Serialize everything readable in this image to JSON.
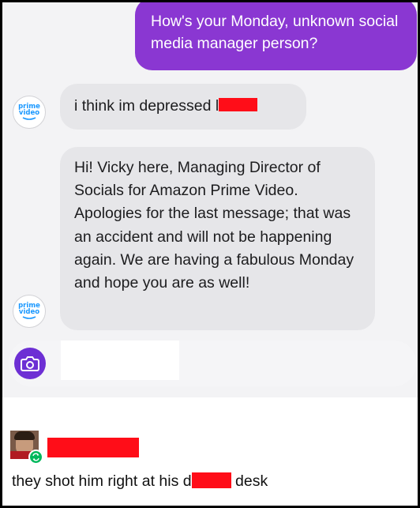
{
  "conversation": {
    "outgoing_message": "How's your Monday, unknown social media manager person?",
    "incoming_message_1": "i think im  depressed l",
    "incoming_message_2": "Hi! Vicky here, Managing Director of Socials for Amazon Prime Video. Apologies for the last message; that was an accident and will not be happening again. We are having a fabulous Monday and hope you are as well!",
    "sender_logo": {
      "line1": "prime",
      "line2": "video",
      "icon": "prime-video-logo-icon"
    }
  },
  "composer": {
    "camera_icon": "camera-icon"
  },
  "post": {
    "caption_part1": "they shot him right at his d",
    "caption_part2": " desk",
    "reblog_icon": "reblog-icon"
  },
  "colors": {
    "outgoing_bubble": "#8a37d2",
    "incoming_bubble": "#e6e6e9",
    "camera_button": "#6d2fd4",
    "redaction": "#ff0d18",
    "prime_blue": "#1a98ff",
    "reblog_green": "#00b85c"
  }
}
